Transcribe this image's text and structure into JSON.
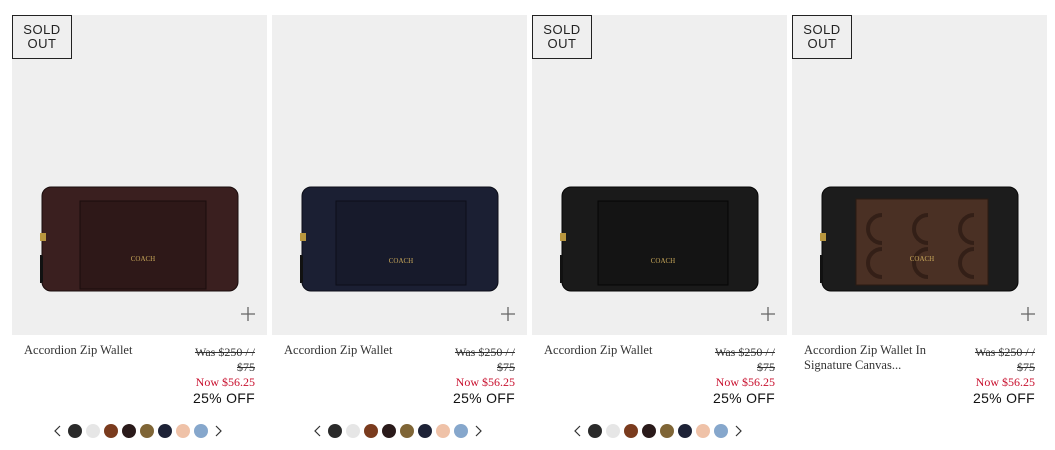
{
  "products": [
    {
      "sold_out_line1": "SOLD",
      "sold_out_line2": "OUT",
      "name": "Accordion Zip Wallet",
      "was_line1": "Was $250 / /",
      "was_line2": "$75",
      "now": "Now $56.25",
      "discount": "25% OFF",
      "wallet_color": "#3a1f1f",
      "pocket_color": "#2e1818",
      "swatches": [
        "#2a2a2a",
        "#e6e6e6",
        "#7a3b1e",
        "#2a1a1a",
        "#7f6536",
        "#1d2236",
        "#efc2a8",
        "#86a7cc"
      ]
    },
    {
      "name": "Accordion Zip Wallet",
      "was_line1": "Was $250 / /",
      "was_line2": "$75",
      "now": "Now $56.25",
      "discount": "25% OFF",
      "wallet_color": "#1b1f33",
      "pocket_color": "#171a2b",
      "swatches": [
        "#2a2a2a",
        "#e6e6e6",
        "#7a3b1e",
        "#2a1a1a",
        "#7f6536",
        "#1d2236",
        "#efc2a8",
        "#86a7cc"
      ]
    },
    {
      "sold_out_line1": "SOLD",
      "sold_out_line2": "OUT",
      "name": "Accordion Zip Wallet",
      "was_line1": "Was $250 / /",
      "was_line2": "$75",
      "now": "Now $56.25",
      "discount": "25% OFF",
      "wallet_color": "#1a1a1a",
      "pocket_color": "#141414",
      "swatches": [
        "#2a2a2a",
        "#e6e6e6",
        "#7a3b1e",
        "#2a1a1a",
        "#7f6536",
        "#1d2236",
        "#efc2a8",
        "#86a7cc"
      ]
    },
    {
      "sold_out_line1": "SOLD",
      "sold_out_line2": "OUT",
      "name_line1": "Accordion Zip Wallet In",
      "name_line2": "Signature Canvas...",
      "was_line1": "Was $250 / /",
      "was_line2": "$75",
      "now": "Now $56.25",
      "discount": "25% OFF",
      "wallet_color": "#1c1c1c",
      "pocket_color": "#4a3024"
    }
  ],
  "brand_mark": "COACH",
  "colors": {
    "image_bg": "#efefef",
    "sale_red": "#c8102e"
  },
  "icons": {
    "add": "plus-icon",
    "prev": "chevron-left-icon",
    "next": "chevron-right-icon"
  }
}
